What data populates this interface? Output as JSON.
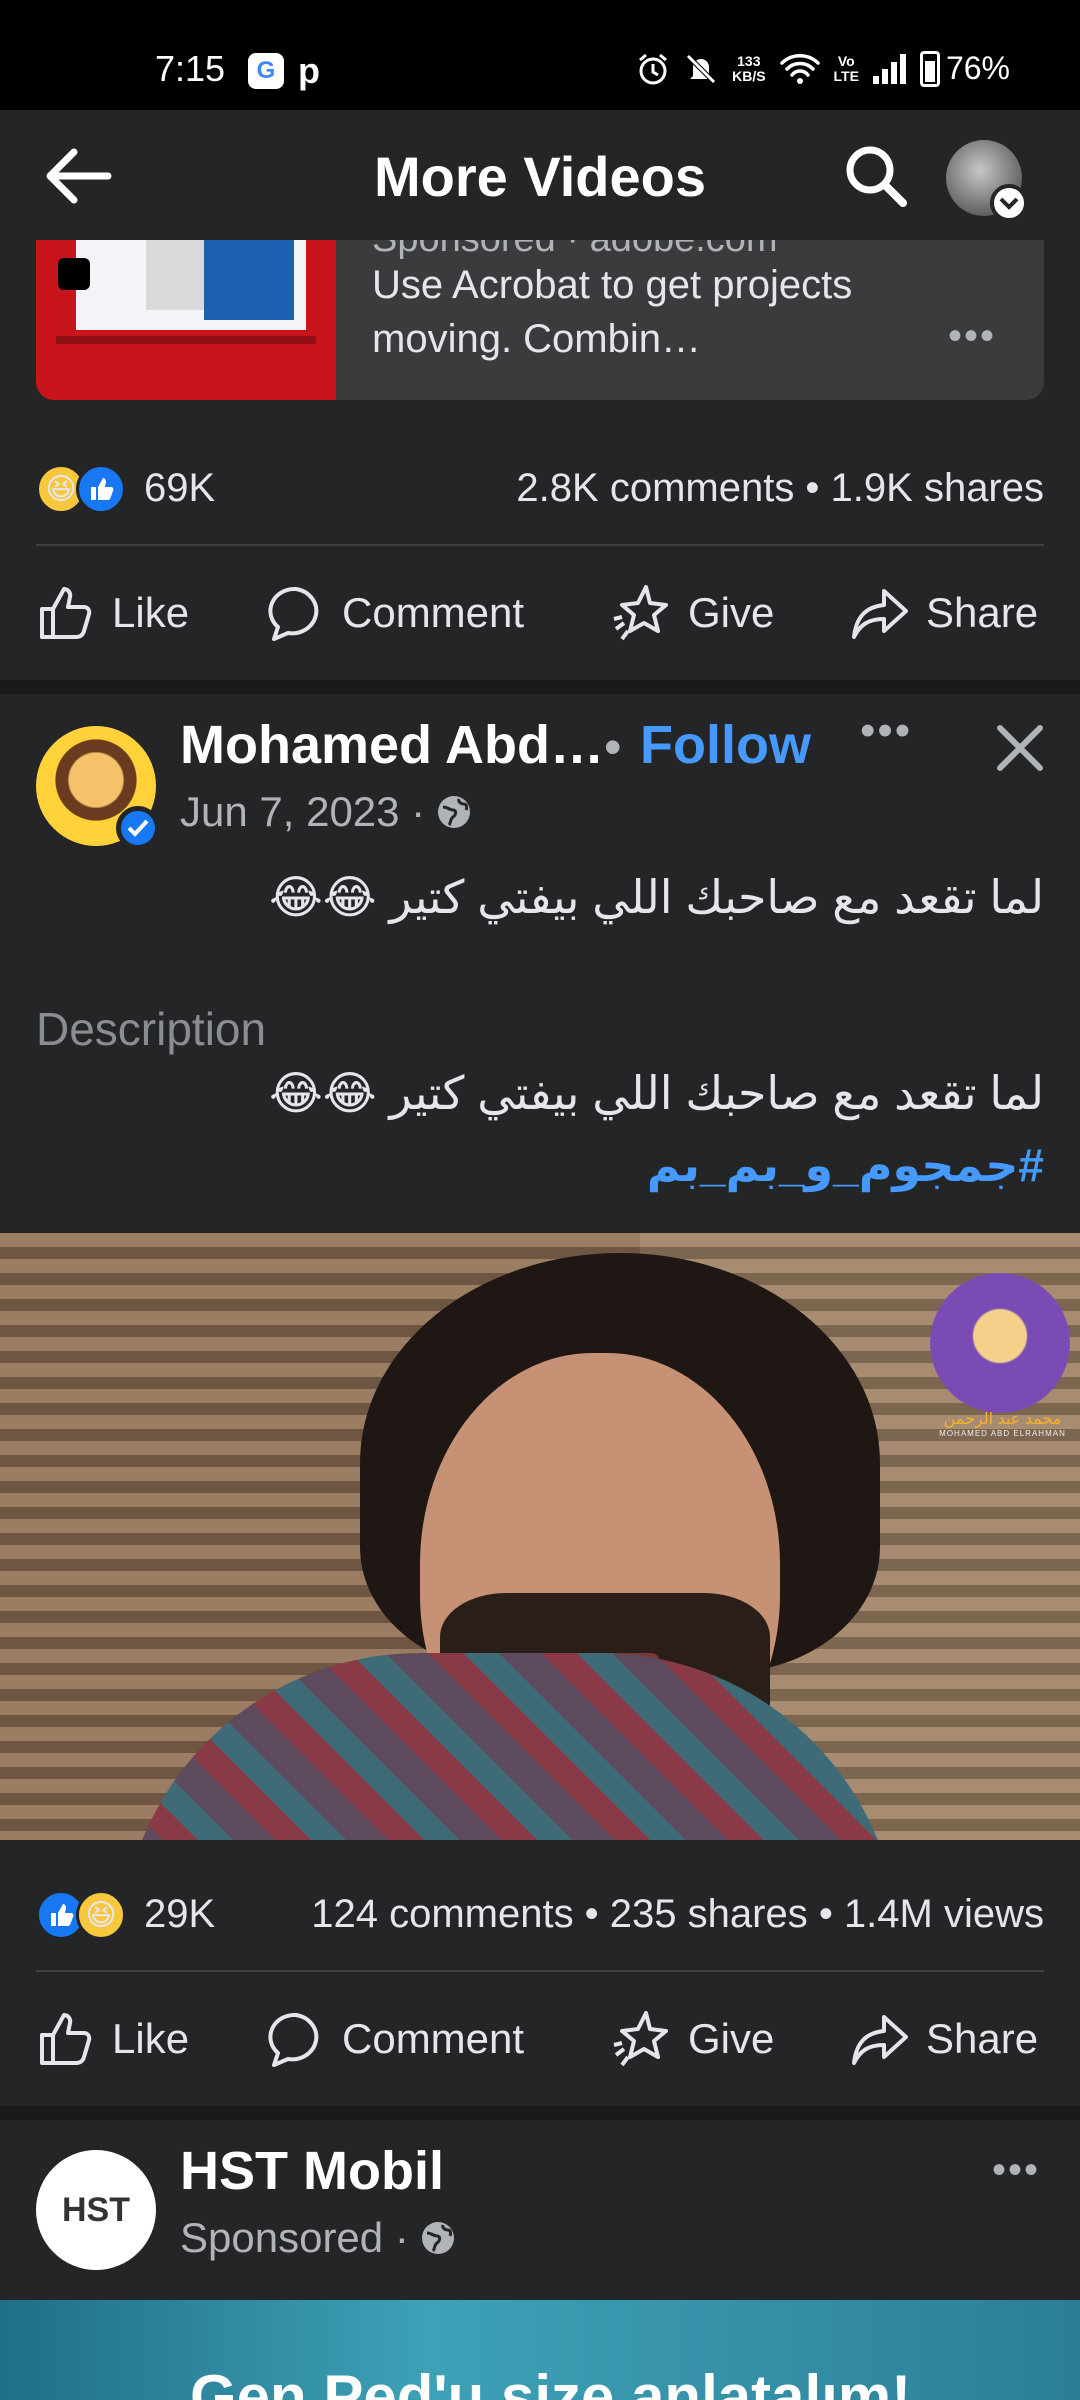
{
  "status_bar": {
    "time": "7:15",
    "network_speed_value": "133",
    "network_speed_unit": "KB/S",
    "volte_top": "Vo",
    "volte_bottom": "LTE",
    "battery": "76%"
  },
  "header": {
    "title": "More Videos"
  },
  "ad": {
    "sponsor_text": "Sponsored · adobe.com",
    "text": "Use Acrobat to get projects moving. Combin…",
    "more": "•••"
  },
  "first_post_stats": {
    "reaction_count": "69K",
    "stats": "2.8K comments • 1.9K shares"
  },
  "actions": {
    "like": "Like",
    "comment": "Comment",
    "give": "Give",
    "share": "Share"
  },
  "post": {
    "author": "Mohamed Abd…",
    "follow_dot": "•",
    "follow": "Follow",
    "more": "•••",
    "date": "Jun 7, 2023 ·",
    "caption": "لما تقعد مع صاحبك اللي بيفتي كتير 😂😂",
    "description_label": "Description",
    "description": "لما تقعد مع صاحبك اللي بيفتي كتير 😂😂",
    "hashtag": "#جمجوم_و_بم_بم",
    "video_badge_name": "محمد عبد الرحمن",
    "video_badge_en": "MOHAMED ABD ELRAHMAN",
    "reaction_count": "29K",
    "stats": "124 comments • 235 shares • 1.4M views"
  },
  "next_post": {
    "author": "HST Mobil",
    "sponsored": "Sponsored ·",
    "logo_text": "HST",
    "more": "•••",
    "banner_text": "Gen Ped'u size anlatalım!"
  },
  "colors": {
    "background": "#242526",
    "separator": "#18191a",
    "accent_blue": "#4599ff",
    "like_blue": "#1877f2"
  }
}
